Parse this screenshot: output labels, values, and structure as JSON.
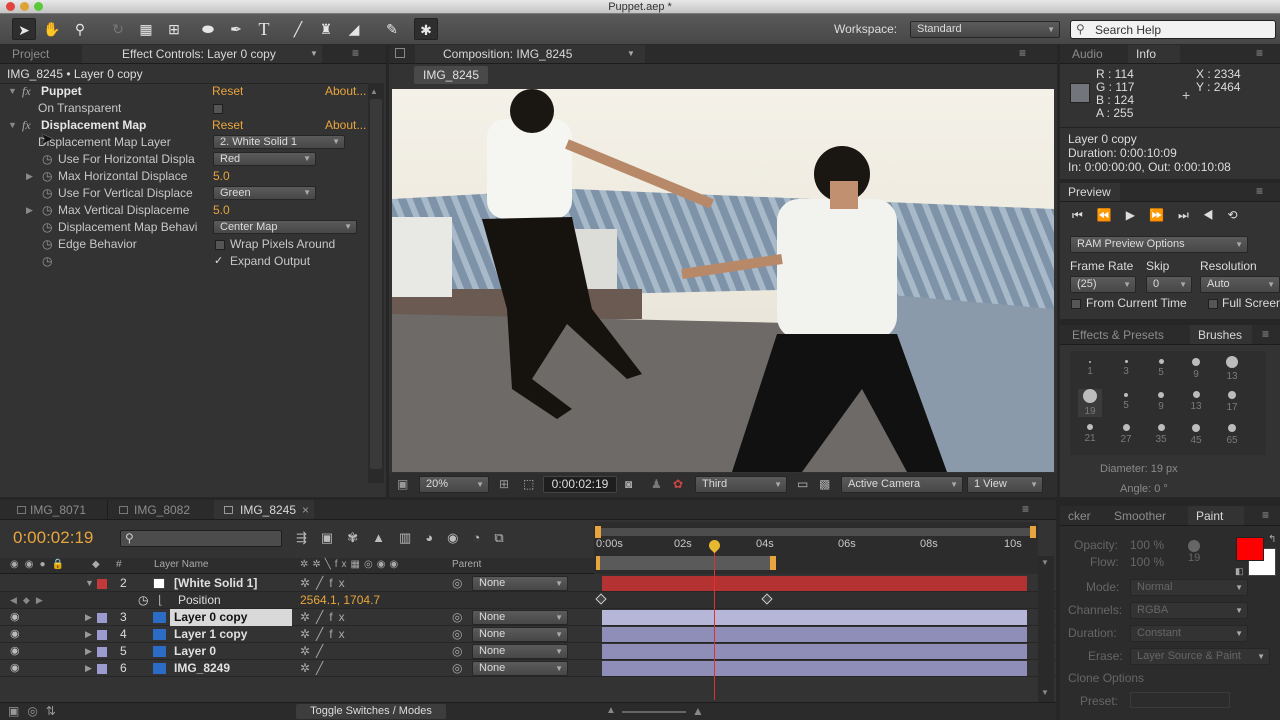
{
  "title": "Puppet.aep *",
  "toolbar": {
    "workspace_label": "Workspace:",
    "workspace_value": "Standard",
    "search_placeholder": "Search Help"
  },
  "project_panel": {
    "tab_project": "Project",
    "tab_effect_controls": "Effect Controls: Layer 0 copy",
    "breadcrumb": "IMG_8245 • Layer 0 copy",
    "effects": [
      {
        "name": "Puppet",
        "reset": "Reset",
        "about": "About..."
      },
      {
        "name": "Displacement Map",
        "reset": "Reset",
        "about": "About..."
      }
    ],
    "rows": {
      "on_transparent": "On Transparent",
      "map_layer_label": "Displacement Map Layer",
      "map_layer_value": "2. White Solid 1",
      "horiz_use_label": "Use For Horizontal Displa",
      "horiz_use_value": "Red",
      "max_horiz_label": "Max Horizontal Displace",
      "max_horiz_value": "5.0",
      "vert_use_label": "Use For Vertical Displace",
      "vert_use_value": "Green",
      "max_vert_label": "Max Vertical Displaceme",
      "max_vert_value": "5.0",
      "behavior_label": "Displacement Map Behavi",
      "behavior_value": "Center Map",
      "edge_label": "Edge Behavior",
      "wrap_label": "Wrap Pixels Around",
      "expand_label": "Expand Output"
    }
  },
  "composition": {
    "tab_label": "Composition: IMG_8245",
    "sub_tab": "IMG_8245",
    "zoom": "20%",
    "timecode": "0:00:02:19",
    "resolution": "Third",
    "camera": "Active Camera",
    "views": "1 View"
  },
  "info": {
    "tab_audio": "Audio",
    "tab_info": "Info",
    "r": "R : 114",
    "g": "G : 117",
    "b": "B : 124",
    "a": "A : 255",
    "x": "X : 2334",
    "y": "Y : 2464",
    "layer": "Layer 0 copy",
    "duration": "Duration: 0:00:10:09",
    "inout": "In: 0:00:00:00, Out: 0:00:10:08"
  },
  "preview": {
    "tab": "Preview",
    "ram_options": "RAM Preview Options",
    "frame_rate_label": "Frame Rate",
    "skip_label": "Skip",
    "resolution_label": "Resolution",
    "frame_rate_value": "(25)",
    "skip_value": "0",
    "resolution_value": "Auto",
    "from_current": "From Current Time",
    "full_screen": "Full Screen"
  },
  "brushes": {
    "tab_effects": "Effects & Presets",
    "tab_brushes": "Brushes",
    "sizes": [
      "1",
      "3",
      "5",
      "9",
      "13",
      "19",
      "5",
      "9",
      "13",
      "17",
      "21",
      "27",
      "35",
      "45",
      "65"
    ],
    "diameter": "Diameter: 19 px",
    "angle": "Angle: 0 °"
  },
  "timeline": {
    "tabs": [
      "IMG_8071",
      "IMG_8082",
      "IMG_8245"
    ],
    "timecode": "0:00:02:19",
    "col_layer_name": "Layer Name",
    "col_parent": "Parent",
    "ruler": [
      "0:00s",
      "02s",
      "04s",
      "06s",
      "08s",
      "10s"
    ],
    "layers": [
      {
        "num": "2",
        "name": "[White Solid 1]",
        "parent": "None",
        "color": "#c03a3a"
      },
      {
        "num": "3",
        "name": "Layer 0 copy",
        "parent": "None",
        "color": "#9b9bd0"
      },
      {
        "num": "4",
        "name": "Layer 1 copy",
        "parent": "None",
        "color": "#9b9bd0"
      },
      {
        "num": "5",
        "name": "Layer 0",
        "parent": "None",
        "color": "#9b9bd0"
      },
      {
        "num": "6",
        "name": "IMG_8249",
        "parent": "None",
        "color": "#9b9bd0"
      }
    ],
    "position_label": "Position",
    "position_value": "2564.1, 1704.7",
    "toggle_label": "Toggle Switches / Modes"
  },
  "paint": {
    "tab_tracker": "cker",
    "tab_smoother": "Smoother",
    "tab_paint": "Paint",
    "opacity_label": "Opacity:",
    "opacity_value": "100 %",
    "flow_label": "Flow:",
    "flow_value": "100 %",
    "brush_size": "19",
    "mode_label": "Mode:",
    "mode_value": "Normal",
    "channels_label": "Channels:",
    "channels_value": "RGBA",
    "duration_label": "Duration:",
    "duration_value": "Constant",
    "erase_label": "Erase:",
    "erase_value": "Layer Source & Paint",
    "clone_options": "Clone Options",
    "preset_label": "Preset:",
    "fg_color": "#ff0000",
    "bg_color": "#ffffff"
  }
}
